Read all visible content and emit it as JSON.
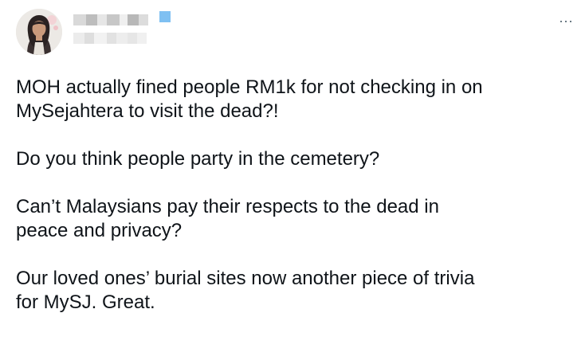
{
  "tweet": {
    "more_label": "···",
    "paragraphs": [
      "MOH actually fined people RM1k for not checking in on\nMySejahtera to visit the dead?!",
      "Do you think people party in the cemetery?",
      "Can’t Malaysians pay their respects to the dead in\npeace and privacy?",
      "Our loved ones’ burial sites now another piece of trivia\nfor MySJ. Great."
    ]
  },
  "colors": {
    "text": "#0f1419",
    "secondary": "#536471",
    "verified_blue": "#7fc0f2"
  },
  "icons": {
    "more": "more-horizontal-icon",
    "verified": "verified-badge-icon"
  }
}
